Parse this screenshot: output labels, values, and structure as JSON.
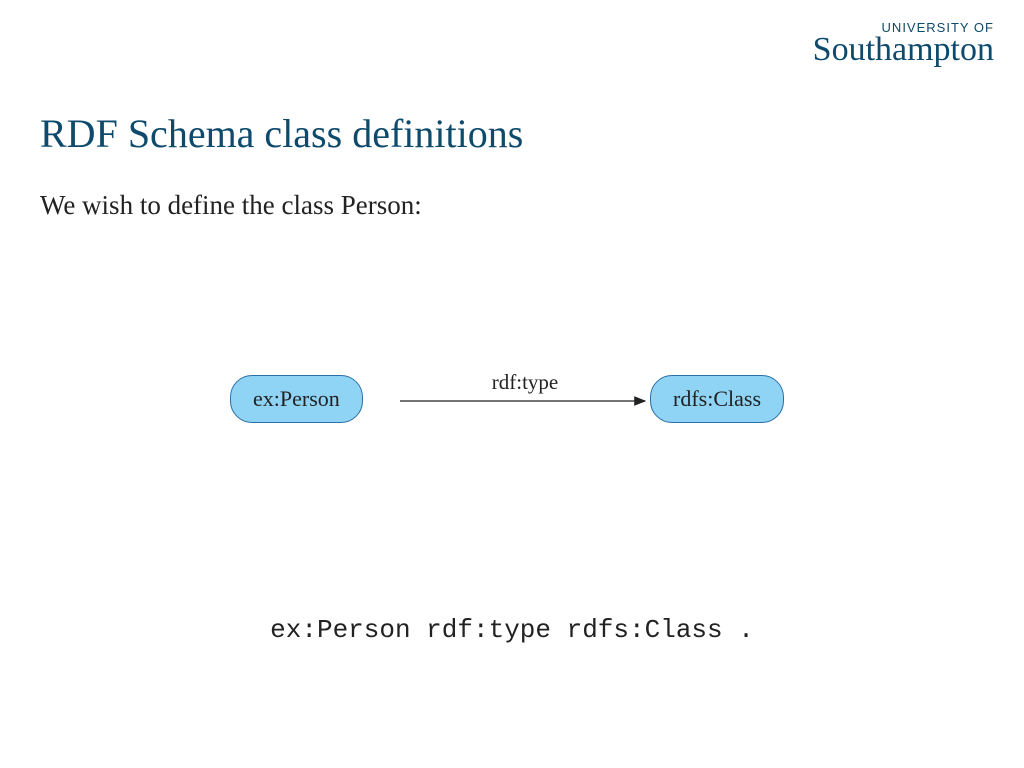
{
  "logo": {
    "prefix": "UNIVERSITY OF",
    "name": "Southampton"
  },
  "title": "RDF Schema class definitions",
  "body": "We wish to define the class Person:",
  "diagram": {
    "left_node": "ex:Person",
    "right_node": "rdfs:Class",
    "edge_label": "rdf:type"
  },
  "code": "ex:Person rdf:type rdfs:Class ."
}
